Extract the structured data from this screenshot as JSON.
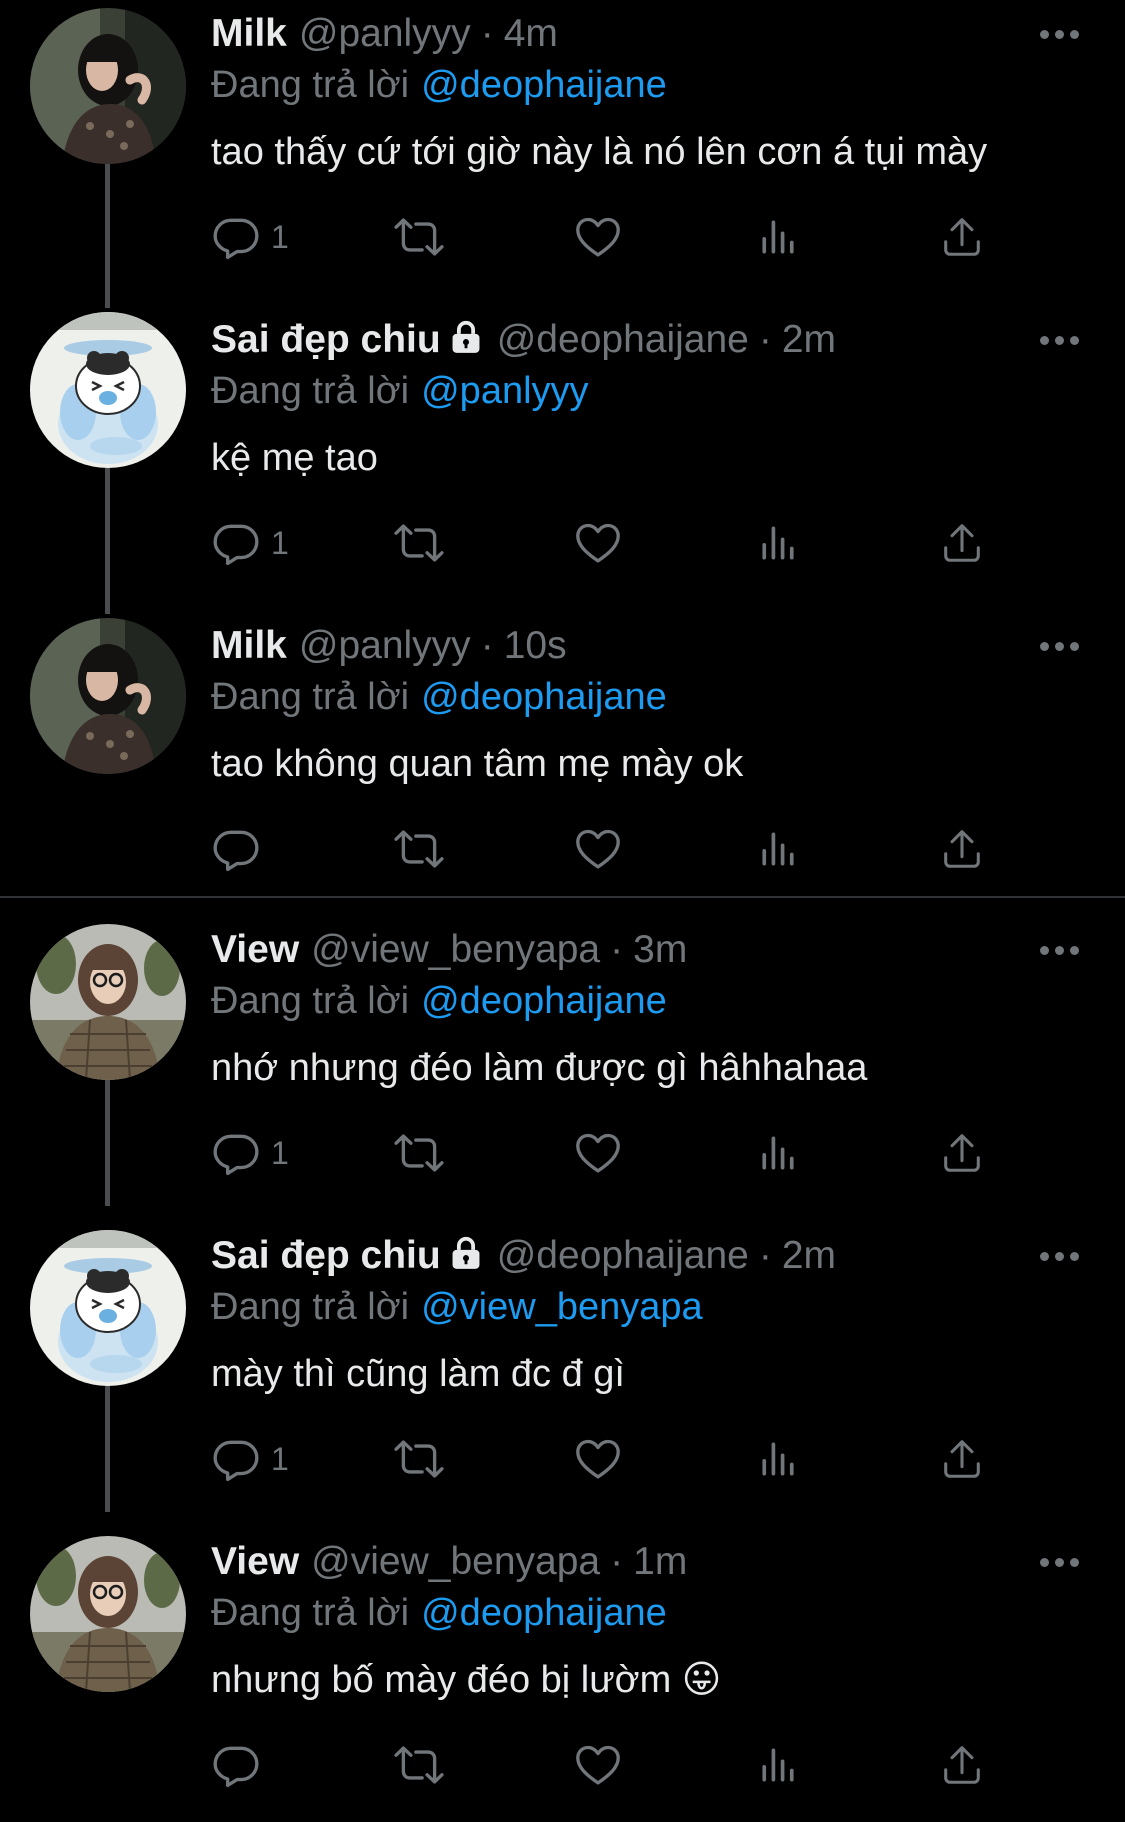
{
  "colors": {
    "background": "#000000",
    "primary_text": "#e7e9ea",
    "secondary_text": "#71767b",
    "link": "#1d9bf0",
    "divider": "#2f3336",
    "thread_line": "#4a4d50"
  },
  "icons": {
    "reply": "speech-bubble-icon",
    "retweet": "retweet-arrows-icon",
    "like": "heart-outline-icon",
    "views": "bar-chart-icon",
    "share": "share-upload-icon",
    "more": "three-dots-icon",
    "protected": "lock-icon"
  },
  "reply_prefix": "Đang trả lời",
  "tweets": [
    {
      "name": "Milk",
      "handle": "@panlyyy",
      "separator": "·",
      "time": "4m",
      "replying_to": "@deophaijane",
      "text": "tao thấy cứ tới giờ này là nó lên cơn á tụi mày",
      "reply_count": "1",
      "protected": false
    },
    {
      "name": "Sai đẹp chiu",
      "handle": "@deophaijane",
      "separator": "·",
      "time": "2m",
      "replying_to": "@panlyyy",
      "text": "kệ mẹ tao",
      "reply_count": "1",
      "protected": true
    },
    {
      "name": "Milk",
      "handle": "@panlyyy",
      "separator": "·",
      "time": "10s",
      "replying_to": "@deophaijane",
      "text": "tao không quan tâm mẹ mày ok",
      "reply_count": "",
      "protected": false
    },
    {
      "name": "View",
      "handle": "@view_benyapa",
      "separator": "·",
      "time": "3m",
      "replying_to": "@deophaijane",
      "text": "nhớ nhưng đéo làm được gì hâhhahaa",
      "reply_count": "1",
      "protected": false
    },
    {
      "name": "Sai đẹp chiu",
      "handle": "@deophaijane",
      "separator": "·",
      "time": "2m",
      "replying_to": "@view_benyapa",
      "text": "mày thì cũng làm đc đ gì",
      "reply_count": "1",
      "protected": true
    },
    {
      "name": "View",
      "handle": "@view_benyapa",
      "separator": "·",
      "time": "1m",
      "replying_to": "@deophaijane",
      "text": "nhưng bố mày đéo bị lườm 😛",
      "reply_count": "",
      "protected": false
    }
  ]
}
